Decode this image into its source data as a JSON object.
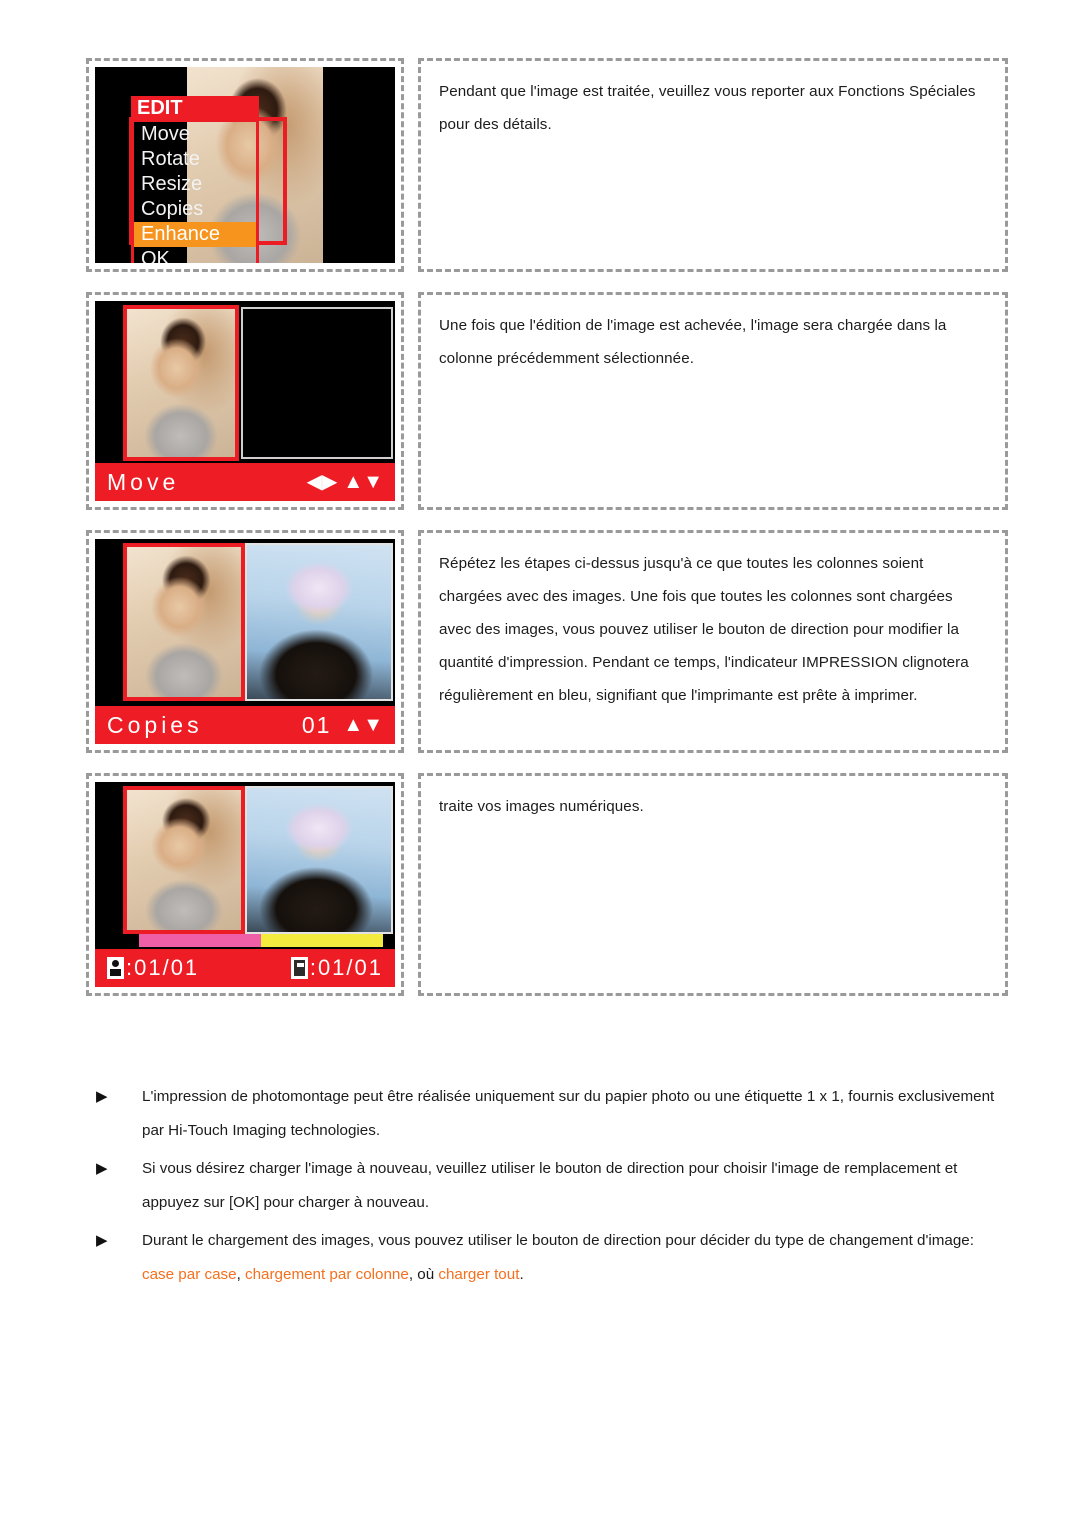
{
  "page": {
    "language": "fr",
    "accent_orange": "#f4701f",
    "lcd_red": "#ee1c25",
    "lcd_highlight": "#f7941e",
    "border_gray": "#9a9a9a"
  },
  "rows": [
    {
      "screenshot": {
        "name": "edit-menu-screen",
        "menu_title": "EDIT",
        "menu_items": [
          "Move",
          "Rotate",
          "Resize",
          "Copies",
          "Enhance",
          "OK"
        ],
        "highlighted_item": "Enhance"
      },
      "text": "Pendant que l'image est traitée, veuillez vous reporter aux Fonctions Spéciales pour des détails."
    },
    {
      "screenshot": {
        "name": "move-screen",
        "status_label": "Move",
        "arrows": [
          "left-right",
          "up-down"
        ]
      },
      "text": "Une fois que l'édition de l'image est achevée, l'image sera chargée dans la colonne précédemment sélectionnée."
    },
    {
      "screenshot": {
        "name": "copies-screen",
        "status_label": "Copies",
        "count": "01",
        "arrows": [
          "up-down"
        ]
      },
      "text": "Répétez les étapes ci-dessus jusqu'à ce que toutes les colonnes soient chargées avec des images. Une fois que toutes les colonnes sont chargées avec des images, vous pouvez utiliser le bouton de direction pour modifier la quantité d'impression. Pendant ce temps, l'indicateur IMPRESSION clignotera régulièrement en bleu, signifiant que l'imprimante est prête à imprimer."
    },
    {
      "screenshot": {
        "name": "print-status-screen",
        "ribbon_counter": ":01/01",
        "paper_counter": ":01/01",
        "meter_left_color": "#ef5fa7",
        "meter_right_color": "#f3ec3f"
      },
      "text": "traite vos images numériques."
    }
  ],
  "notes": {
    "marker": "▶",
    "items": [
      {
        "plain_before": "L'impression de photomontage peut être réalisée uniquement sur du papier photo ou une étiquette 1 x 1, fournis exclusivement par Hi-Touch Imaging technologies.",
        "highlights": []
      },
      {
        "plain_before": "Si vous désirez charger l'image à nouveau, veuillez utiliser le bouton de direction pour choisir l'image de remplacement et appuyez sur [OK] pour charger à nouveau.",
        "highlights": []
      },
      {
        "plain_before": "Durant le chargement des images, vous pouvez utiliser le bouton de direction pour décider du type de changement d'image: ",
        "highlights": [
          "case par case",
          "chargement par colonne",
          "charger tout"
        ],
        "sep1": ", ",
        "sep2": ", où ",
        "plain_after": "."
      }
    ]
  }
}
